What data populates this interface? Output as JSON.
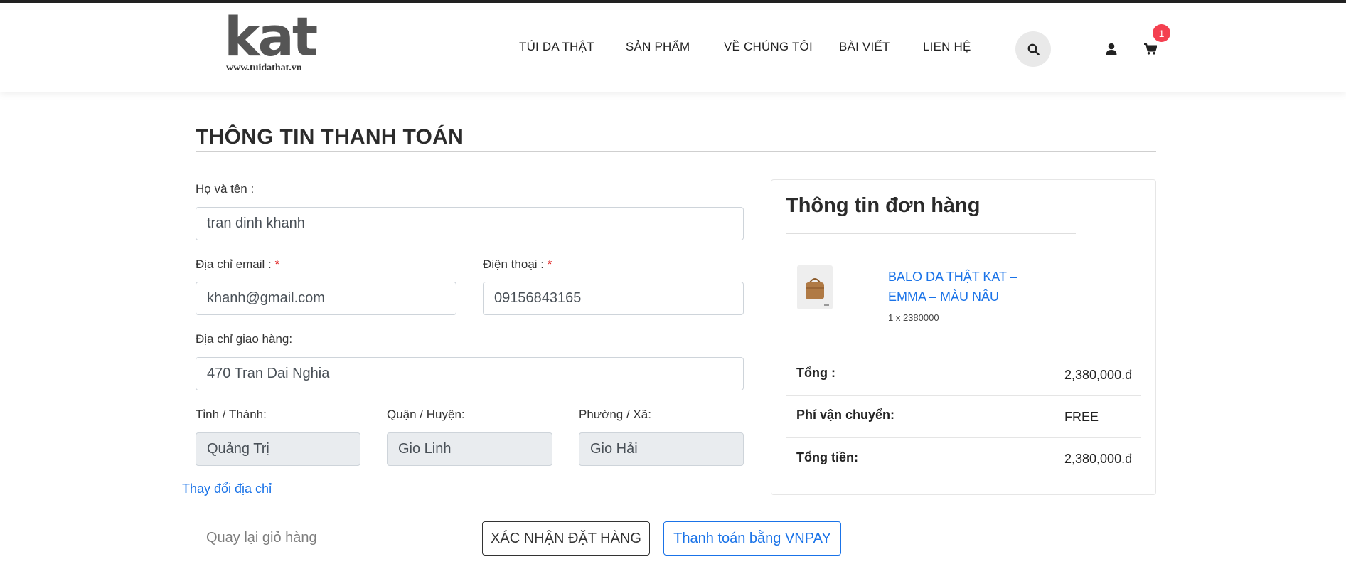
{
  "header": {
    "logo_text": "kat",
    "logo_url_text": "www.tuidathat.vn",
    "nav": [
      "TÚI DA THẬT",
      "SẢN PHẨM",
      "VỀ CHÚNG TÔI",
      "BÀI VIẾT",
      "LIEN HỆ"
    ],
    "cart_count": "1",
    "icons": {
      "search": "search-icon",
      "user": "user-icon",
      "cart": "cart-icon"
    }
  },
  "checkout": {
    "title": "THÔNG TIN THANH TOÁN",
    "fields": {
      "name": {
        "label": "Họ và tên :",
        "value": "tran dinh khanh"
      },
      "email": {
        "label": "Địa chỉ email :",
        "required": "*",
        "value": "khanh@gmail.com"
      },
      "phone": {
        "label": "Điện thoại :",
        "required": "*",
        "value": "09156843165"
      },
      "address": {
        "label": "Địa chỉ giao hàng:",
        "value": "470 Tran Dai Nghia"
      },
      "province": {
        "label": "Tỉnh / Thành:",
        "value": "Quảng Trị"
      },
      "district": {
        "label": "Quận / Huyện:",
        "value": "Gio Linh"
      },
      "ward": {
        "label": "Phường / Xã:",
        "value": "Gio Hải"
      }
    },
    "change_address": "Thay đổi địa chỉ",
    "back_to_cart": "Quay lại giỏ hàng",
    "confirm_button": "XÁC NHẬN ĐẶT HÀNG",
    "vnpay_button": "Thanh toán bằng VNPAY"
  },
  "order": {
    "title": "Thông tin đơn hàng",
    "product_name": "BALO DA THẬT KAT – EMMA – MÀU NÂU",
    "product_qty": "1 x 2380000",
    "subtotal_label": "Tổng :",
    "subtotal_value": "2,380,000.đ",
    "shipping_label": "Phí vận chuyển:",
    "shipping_value": "FREE",
    "total_label": "Tổng tiền:",
    "total_value": "2,380,000.đ"
  },
  "colors": {
    "accent": "#1a73e8",
    "badge": "#f44050",
    "required": "#e02020"
  }
}
